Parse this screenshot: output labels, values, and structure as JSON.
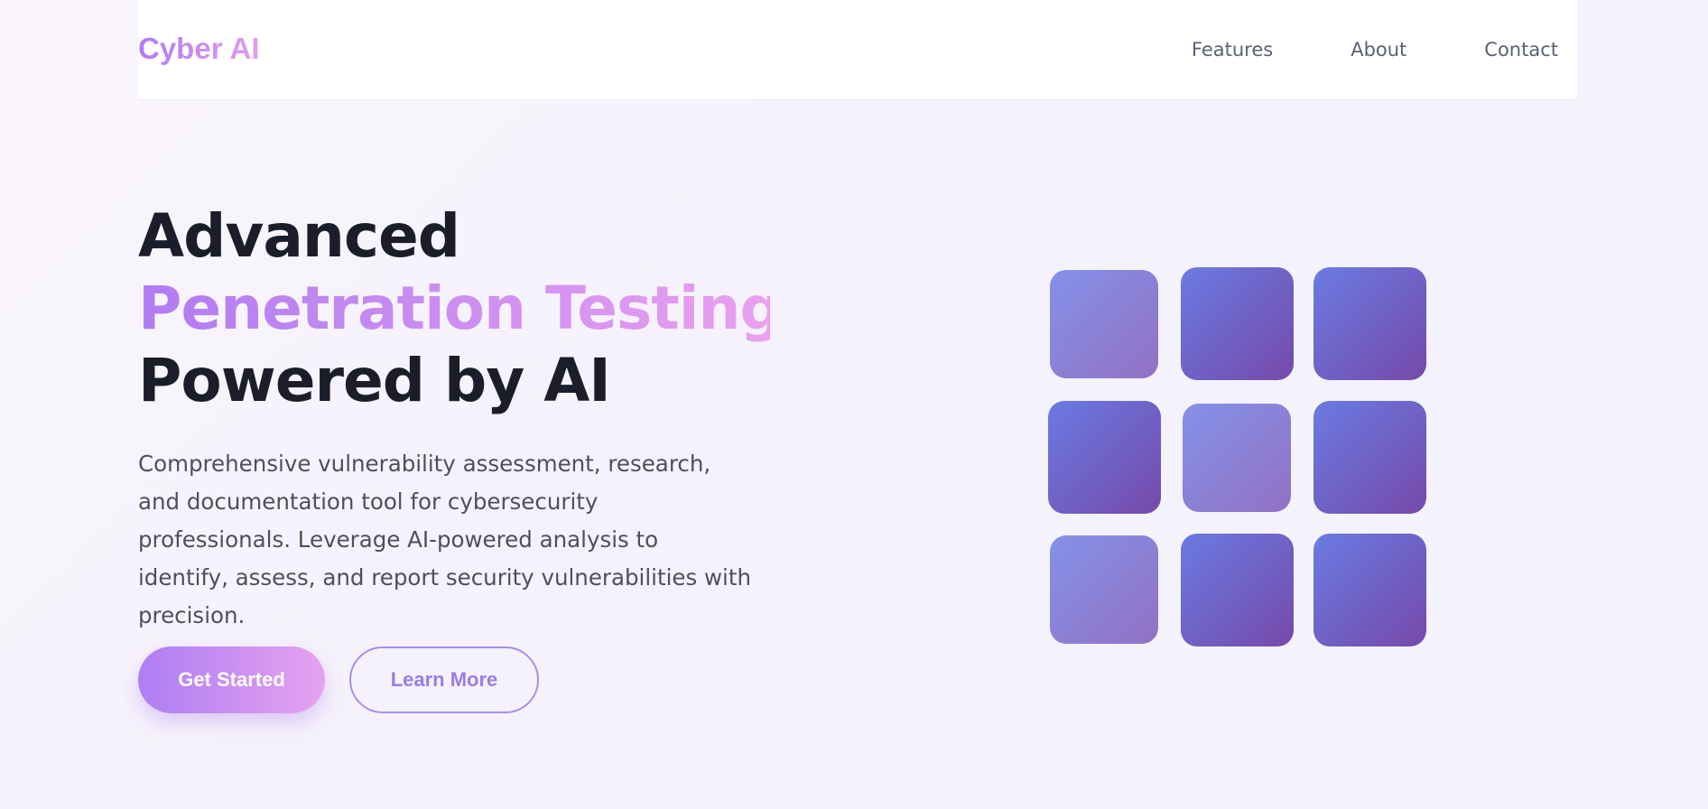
{
  "nav": {
    "logo": "Cyber AI",
    "links": [
      "Features",
      "About",
      "Contact"
    ]
  },
  "hero": {
    "title_line1": "Advanced",
    "title_line2": "Penetration Testing",
    "title_line3": "Powered by AI",
    "subtitle": "Comprehensive vulnerability assessment, research, and documentation tool for cybersecurity professionals. Leverage AI-powered analysis to identify, assess, and report security vulnerabilities with precision.",
    "primary_button": "Get Started",
    "secondary_button": "Learn More"
  },
  "colors": {
    "brand_gradient_start": "#b07cf2",
    "brand_gradient_end": "#e29cf0",
    "heading_text": "#1b1e2a",
    "body_text": "#4b5061",
    "tile_blue": "#6a7be2",
    "tile_purple": "#7649aa"
  }
}
